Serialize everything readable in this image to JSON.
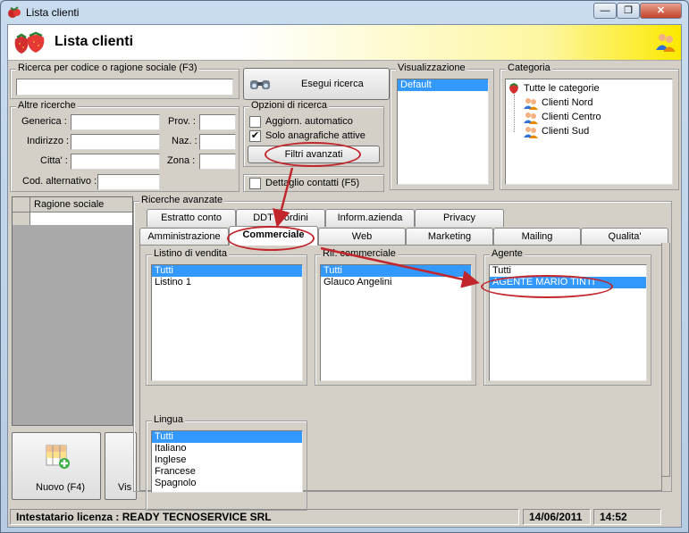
{
  "window": {
    "title": "Lista clienti",
    "min": "—",
    "max": "❐",
    "close": "✕"
  },
  "header": {
    "title": "Lista clienti"
  },
  "search": {
    "code_label": "Ricerca per codice o ragione sociale (F3)",
    "code_value": "",
    "execute_button": "Esegui ricerca"
  },
  "other": {
    "group_label": "Altre ricerche",
    "generica": "Generica :",
    "indirizzo": "Indirizzo :",
    "citta": "Citta' :",
    "prov": "Prov. :",
    "naz": "Naz. :",
    "zona": "Zona :",
    "cod_alt": "Cod. alternativo :"
  },
  "options": {
    "group_label": "Opzioni di ricerca",
    "auto_update": {
      "label": "Aggiorn. automatico",
      "checked": false
    },
    "active_only": {
      "label": "Solo anagrafiche attive",
      "checked": true
    },
    "advanced_button": "Filtri avanzati",
    "contact_detail": {
      "label": "Dettaglio contatti (F5)",
      "checked": false
    }
  },
  "view": {
    "group_label": "Visualizzazione",
    "items": [
      "Default"
    ]
  },
  "category": {
    "group_label": "Categoria",
    "root": "Tutte le categorie",
    "children": [
      "Clienti Nord",
      "Clienti Centro",
      "Clienti Sud"
    ]
  },
  "grid": {
    "header": "Ragione sociale"
  },
  "buttons": {
    "new": "Nuovo (F4)",
    "vis": "Vis"
  },
  "advanced": {
    "group_label": "Ricerche avanzate",
    "tabs_back": [
      "Estratto conto",
      "DDT e ordini",
      "Inform.azienda",
      "Privacy"
    ],
    "tabs_front": [
      "Amministrazione",
      "Commerciale",
      "Web",
      "Marketing",
      "Mailing",
      "Qualita'"
    ],
    "listino": {
      "label": "Listino di vendita",
      "items": [
        "Tutti",
        "Listino 1"
      ]
    },
    "rif": {
      "label": "Rif. commerciale",
      "items": [
        "Tutti",
        "Glauco Angelini"
      ]
    },
    "agente": {
      "label": "Agente",
      "items": [
        "Tutti",
        "AGENTE MARIO TINTI"
      ]
    },
    "lingua": {
      "label": "Lingua",
      "items": [
        "Tutti",
        "Italiano",
        "Inglese",
        "Francese",
        "Spagnolo"
      ]
    }
  },
  "status": {
    "license": "Intestatario licenza : READY TECNOSERVICE SRL",
    "date": "14/06/2011",
    "time": "14:52"
  },
  "colors": {
    "selection": "#3399ff",
    "annotation": "#c0262c",
    "header_yellow": "#fbe900"
  }
}
